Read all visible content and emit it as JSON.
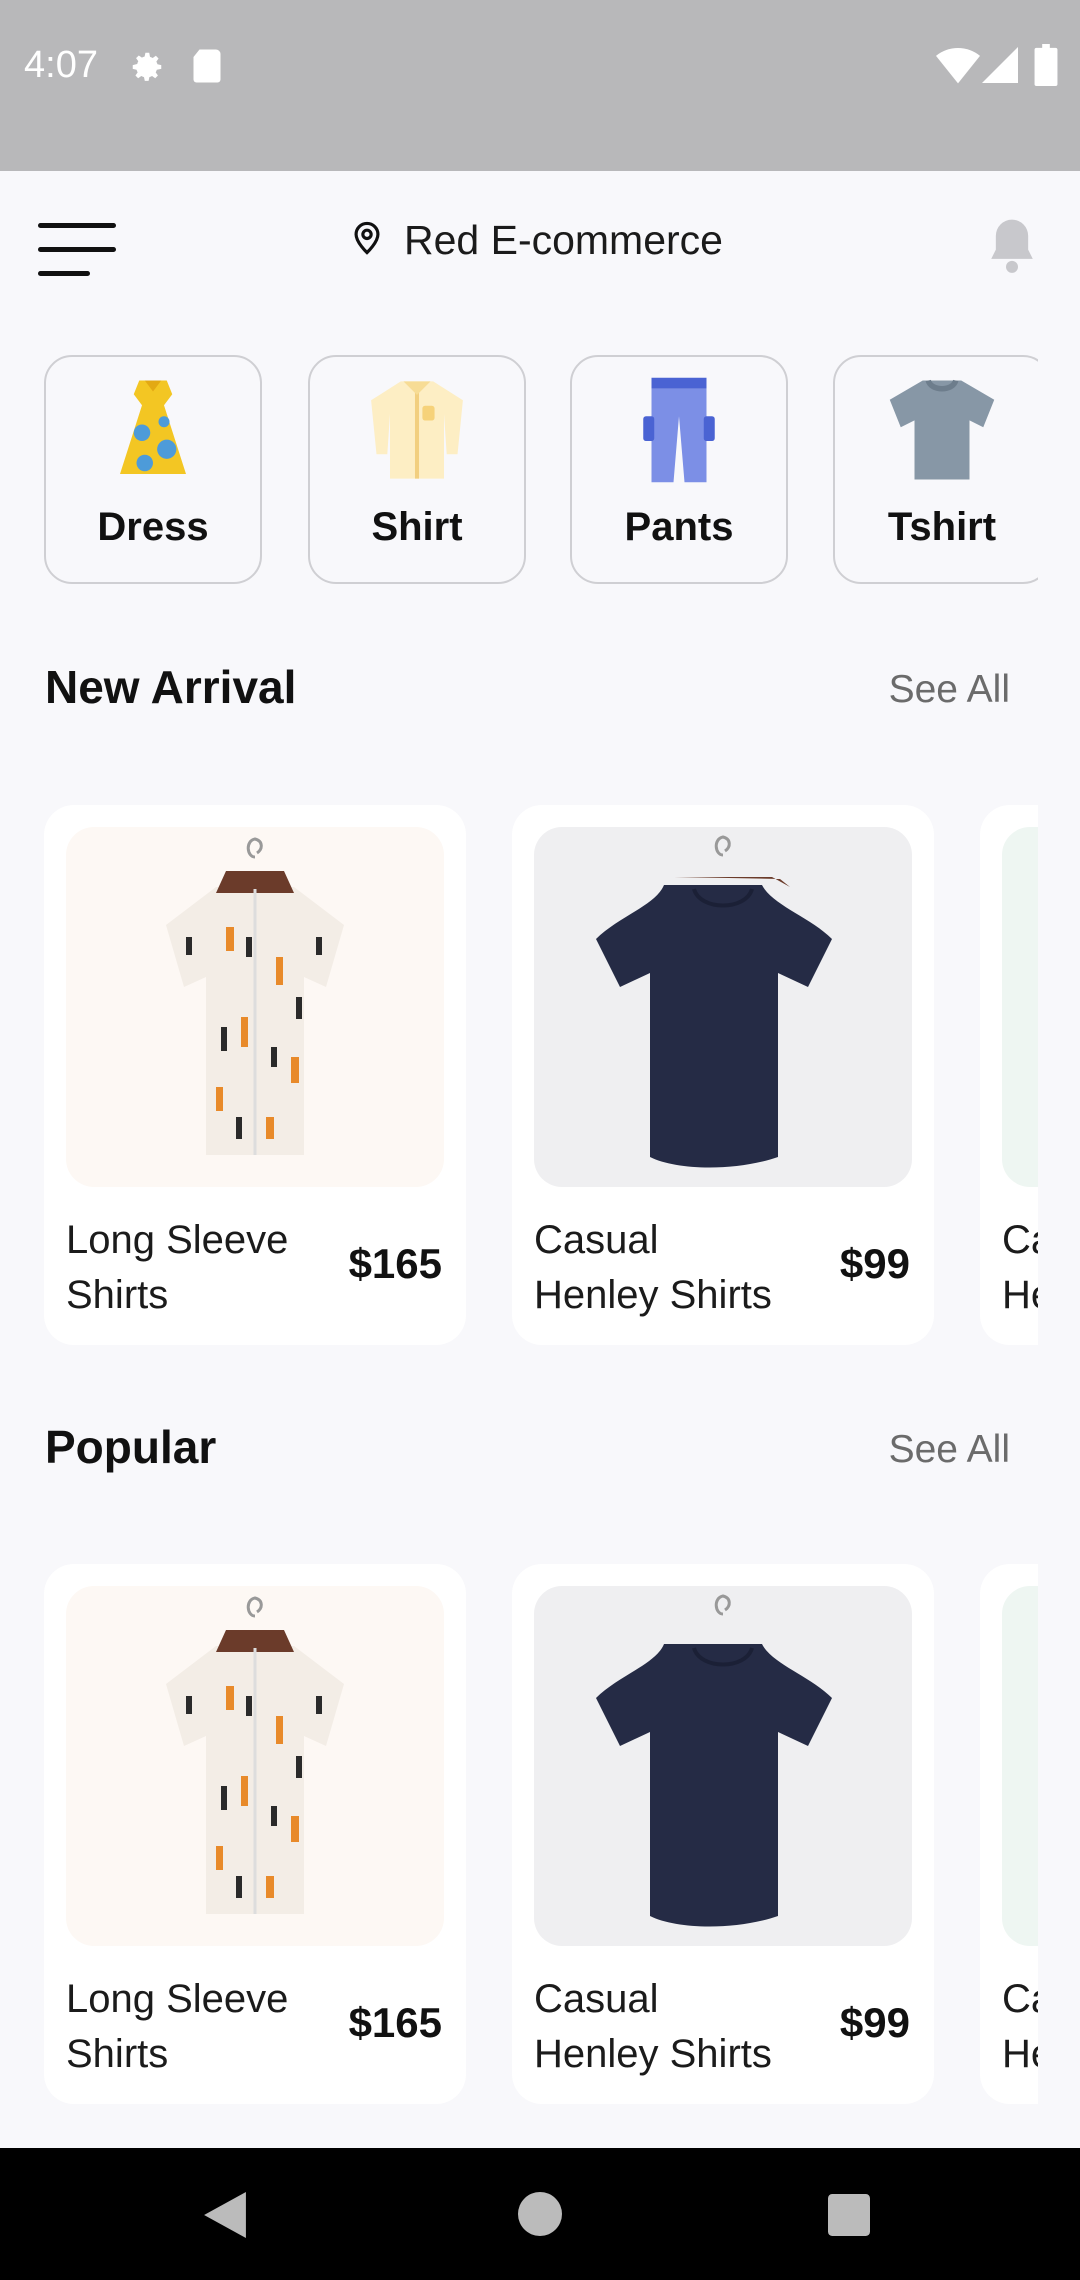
{
  "status": {
    "time": "4:07"
  },
  "header": {
    "title": "Red E-commerce"
  },
  "categories": [
    {
      "label": "Dress",
      "icon": "dress-icon"
    },
    {
      "label": "Shirt",
      "icon": "shirt-icon"
    },
    {
      "label": "Pants",
      "icon": "pants-icon"
    },
    {
      "label": "Tshirt",
      "icon": "tshirt-icon"
    }
  ],
  "new_arrival": {
    "title": "New Arrival",
    "see_all": "See All",
    "products": [
      {
        "name": "Long Sleeve Shirts",
        "price": "$165"
      },
      {
        "name": "Casual Henley Shirts",
        "price": "$99"
      },
      {
        "name": "Casual Henley Shirts",
        "price": ""
      }
    ]
  },
  "popular": {
    "title": "Popular",
    "see_all": "See All",
    "products": [
      {
        "name": "Long Sleeve Shirts",
        "price": "$165"
      },
      {
        "name": "Casual Henley Shirts",
        "price": "$99"
      },
      {
        "name": "Casual Henley Shirts",
        "price": ""
      }
    ]
  },
  "colors": {
    "status_bar": "#b8b8ba",
    "background": "#f8f8fb",
    "see_all": "#6b6b6b"
  }
}
